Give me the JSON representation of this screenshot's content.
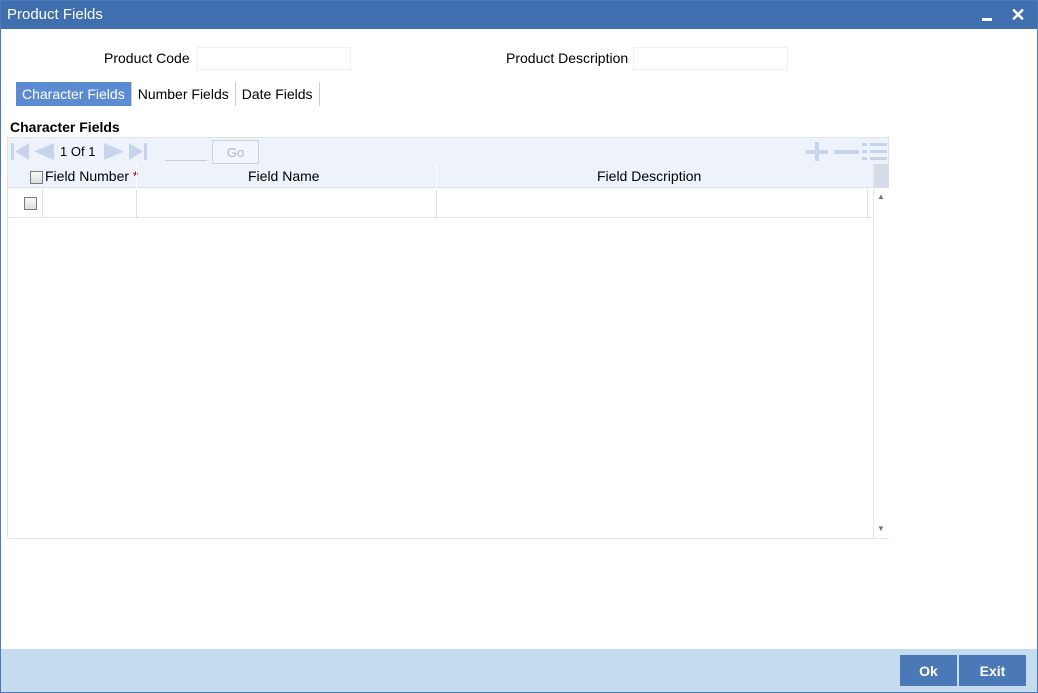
{
  "window": {
    "title": "Product Fields",
    "minimize_icon": "minimize-icon",
    "close_icon": "close-icon",
    "close_glyph": "✕"
  },
  "form": {
    "product_code_label": "Product Code",
    "product_code_value": "",
    "product_description_label": "Product Description",
    "product_description_value": ""
  },
  "tabs": [
    {
      "label": "Character Fields",
      "active": true
    },
    {
      "label": "Number Fields",
      "active": false
    },
    {
      "label": "Date Fields",
      "active": false
    }
  ],
  "section": {
    "title": "Character Fields"
  },
  "grid": {
    "pager": {
      "current": "1",
      "of_label": "Of",
      "total": "1",
      "goto_value": "",
      "go_label": "Go"
    },
    "columns": [
      {
        "label": "Field Number",
        "required": true,
        "required_mark": "*"
      },
      {
        "label": "Field Name"
      },
      {
        "label": "Field Description"
      }
    ],
    "rows": [
      {
        "field_number": "",
        "field_name": "",
        "field_description": ""
      }
    ],
    "toolbar_icons": [
      "first-page-icon",
      "previous-page-icon",
      "next-page-icon",
      "last-page-icon",
      "add-row-icon",
      "delete-row-icon",
      "single-view-icon"
    ]
  },
  "footer": {
    "ok_label": "Ok",
    "exit_label": "Exit"
  },
  "colors": {
    "titlebar": "#3f6fae",
    "active_tab": "#5b8bd0",
    "footer": "#c5dcf0",
    "button": "#4b79b8",
    "required": "#c00000"
  }
}
